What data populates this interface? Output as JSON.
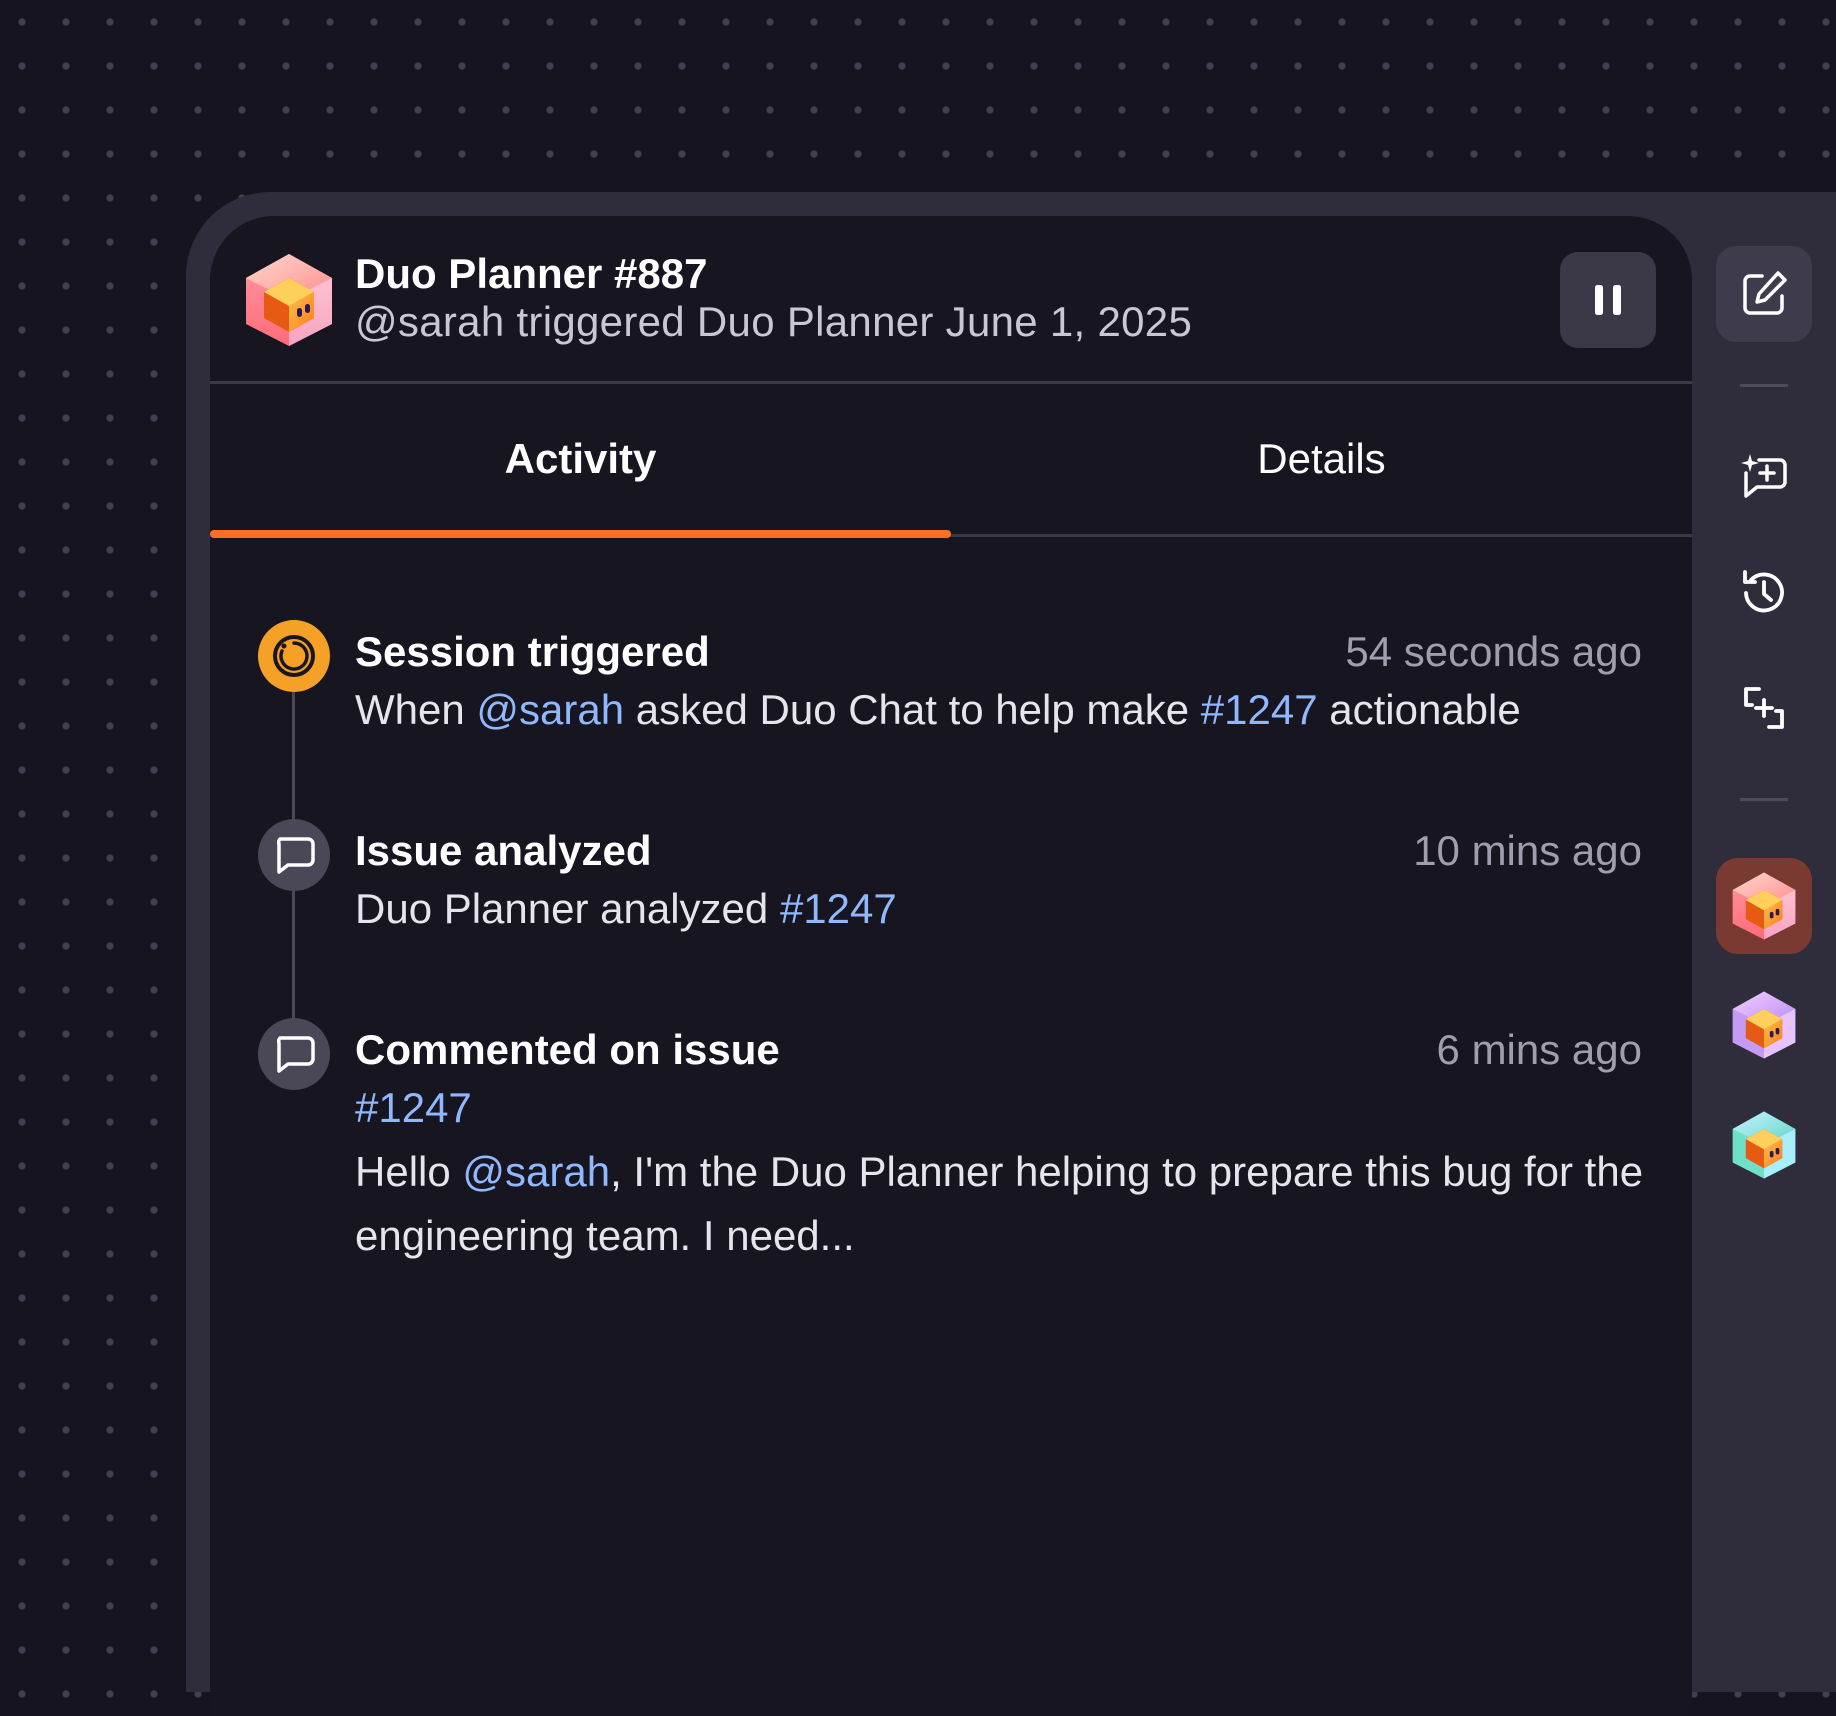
{
  "header": {
    "title": "Duo Planner #887",
    "subtitle": "@sarah triggered Duo Planner June 1, 2025",
    "logo_icon": "duo-planner-cube-icon",
    "pause_icon": "pause-icon"
  },
  "tabs": [
    {
      "label": "Activity",
      "active": true
    },
    {
      "label": "Details",
      "active": false
    }
  ],
  "accent_color": "#fc6d26",
  "link_color": "#8fb8ff",
  "events": [
    {
      "icon": "session-spinner-icon",
      "title": "Session triggered",
      "time": "54 seconds ago",
      "body": [
        "When ",
        "@sarah",
        " asked Duo Chat to help make ",
        "#1247",
        " actionable"
      ]
    },
    {
      "icon": "comment-icon",
      "title": "Issue analyzed",
      "time": "10 mins ago",
      "body": [
        "Duo Planner analyzed ",
        "#1247"
      ]
    },
    {
      "icon": "comment-icon",
      "title": "Commented on issue",
      "time": "6 mins ago",
      "ref": "#1247",
      "body": [
        "Hello ",
        "@sarah",
        ", I'm the Duo Planner helping to prepare this bug for the engineering team. I need..."
      ]
    }
  ],
  "sidebar": {
    "items": [
      {
        "icon": "edit-icon"
      },
      {
        "icon": "ai-chat-icon"
      },
      {
        "icon": "history-icon"
      },
      {
        "icon": "flow-icon"
      },
      {
        "icon": "duo-planner-agent-icon",
        "active": true
      },
      {
        "icon": "duo-agent-purple-icon"
      },
      {
        "icon": "duo-agent-teal-icon"
      }
    ]
  }
}
